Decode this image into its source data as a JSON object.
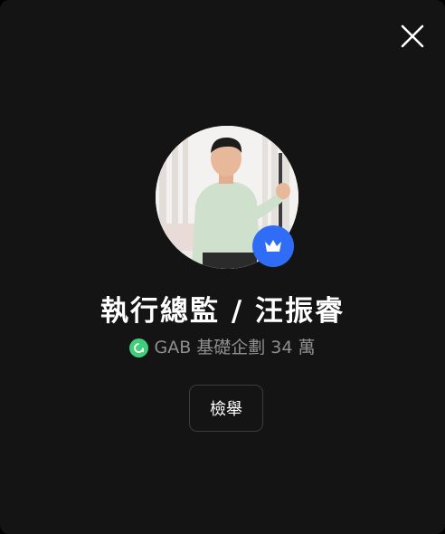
{
  "profile": {
    "name": "執行總監 / 汪振睿",
    "stats": "GAB 基礎企劃 34 萬",
    "avatar_alt": "profile photo"
  },
  "actions": {
    "report_label": "檢舉"
  },
  "icons": {
    "close": "close-icon",
    "badge": "crown-icon",
    "coin": "coin-icon"
  },
  "colors": {
    "background": "#141414",
    "badge": "#2f6df6",
    "coin": "#3fcf7b",
    "stats_text": "#8f8f8f"
  }
}
